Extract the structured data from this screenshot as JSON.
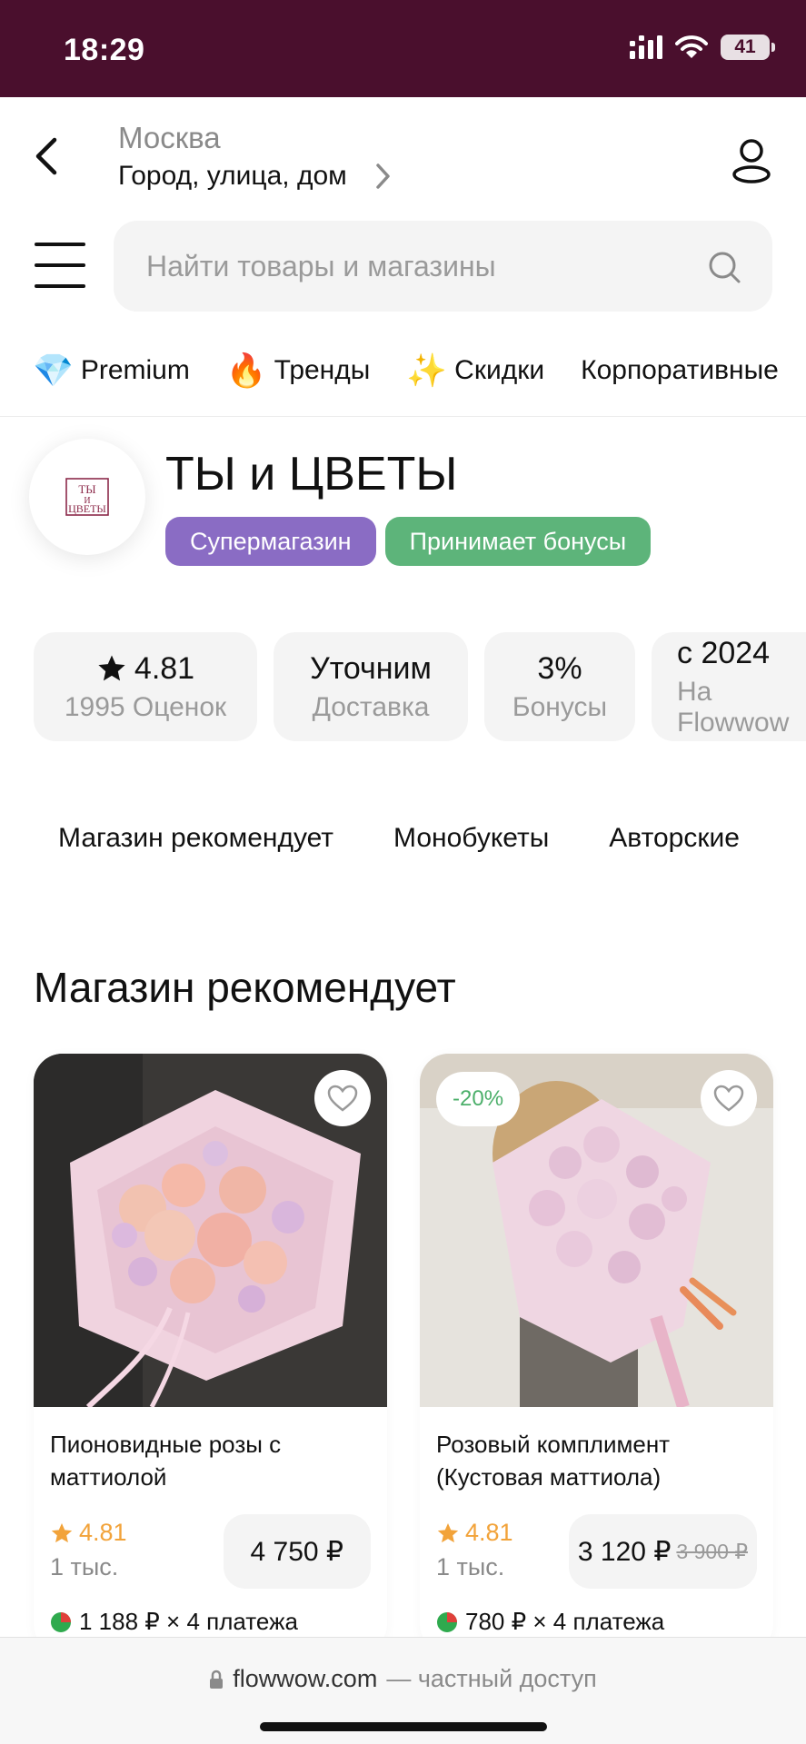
{
  "status_bar": {
    "time": "18:29",
    "battery": "41"
  },
  "header": {
    "city": "Москва",
    "address": "Город, улица, дом"
  },
  "search": {
    "placeholder": "Найти товары и магазины"
  },
  "categories": [
    {
      "emoji": "💎",
      "label": "Premium"
    },
    {
      "emoji": "🔥",
      "label": "Тренды"
    },
    {
      "emoji": "✨",
      "label": "Скидки"
    },
    {
      "emoji": "",
      "label": "Корпоративные"
    }
  ],
  "shop": {
    "name": "ТЫ и ЦВЕТЫ",
    "logo_text": "ТЫ И ЦВЕТЫ",
    "badges": [
      "Супермагазин",
      "Принимает бонусы"
    ]
  },
  "stats": [
    {
      "value": "4.81",
      "label": "1995 Оценок",
      "icon": "star-icon"
    },
    {
      "value": "Уточним",
      "label": "Доставка"
    },
    {
      "value": "3%",
      "label": "Бонусы"
    },
    {
      "value": "с 2024",
      "label": "На Flowwow"
    }
  ],
  "section_tabs": [
    "Магазин рекомендует",
    "Монобукеты",
    "Авторские"
  ],
  "section_title": "Магазин рекомендует",
  "products": [
    {
      "title": "Пионовидные розы с маттиолой",
      "rating": "4.81",
      "reviews": "1 тыс.",
      "price": "4 750 ₽",
      "installment": "1 188 ₽ × 4 платежа"
    },
    {
      "title": "Розовый комплимент (Кустовая маттиола)",
      "discount": "-20%",
      "rating": "4.81",
      "reviews": "1 тыс.",
      "price": "3 120 ₽",
      "old_price": "3 900 ₽",
      "installment": "780 ₽ × 4 платежа"
    }
  ],
  "browser": {
    "domain": "flowwow.com",
    "note": "— частный доступ"
  },
  "colors": {
    "status_bar": "#4a0f2d",
    "super_badge": "#8a6cc4",
    "bonus_badge": "#5db47a",
    "rating": "#f2a33a"
  }
}
